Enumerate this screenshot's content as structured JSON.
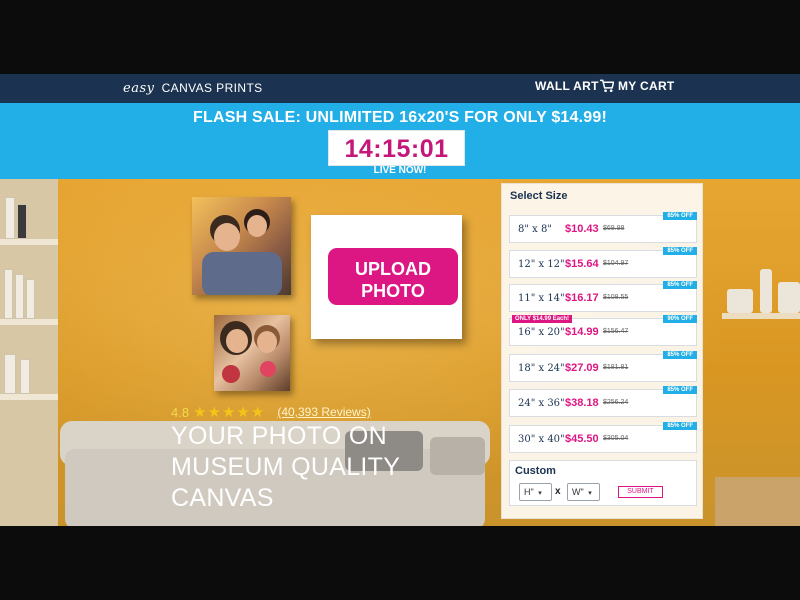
{
  "nav": {
    "brand_easy": "easy",
    "brand_name": "CANVAS PRINTS",
    "wall_art": "WALL ART",
    "my_cart": "MY CART"
  },
  "flash": {
    "title": "FLASH SALE: UNLIMITED 16x20'S FOR ONLY $14.99!",
    "timer": "14:15:01",
    "live": "LIVE NOW!"
  },
  "hero": {
    "upload_label_line1": "UPLOAD",
    "upload_label_line2": "PHOTO",
    "rating": "4.8",
    "stars": "★★★★★",
    "reviews": "(40,393 Reviews)",
    "headline_line1": "YOUR PHOTO ON",
    "headline_line2": "MUSEUM QUALITY",
    "headline_line3": "CANVAS"
  },
  "sizes": {
    "title": "Select Size",
    "rows": [
      {
        "size": "8\" x 8\"",
        "price": "$10.43",
        "old": "$69.98",
        "badge": "85% OFF"
      },
      {
        "size": "12\" x 12\"",
        "price": "$15.64",
        "old": "$104.97",
        "badge": "85% OFF"
      },
      {
        "size": "11\" x 14\"",
        "price": "$16.17",
        "old": "$108.55",
        "badge": "85% OFF"
      },
      {
        "size": "16\" x 20\"",
        "price": "$14.99",
        "old": "$156.47",
        "badge": "90% OFF",
        "promo": "ONLY $14.99 Each!"
      },
      {
        "size": "18\" x 24\"",
        "price": "$27.09",
        "old": "$181.81",
        "badge": "85% OFF"
      },
      {
        "size": "24\" x 36\"",
        "price": "$38.18",
        "old": "$256.24",
        "badge": "85% OFF"
      },
      {
        "size": "30\" x 40\"",
        "price": "$45.50",
        "old": "$305.04",
        "badge": "85% OFF"
      }
    ],
    "custom": {
      "title": "Custom",
      "height_value": "H\"",
      "width_value": "W\"",
      "separator": "x",
      "submit": "SUBMIT"
    }
  },
  "colors": {
    "navy": "#1b3350",
    "sky": "#22aee6",
    "magenta": "#dc1682"
  }
}
